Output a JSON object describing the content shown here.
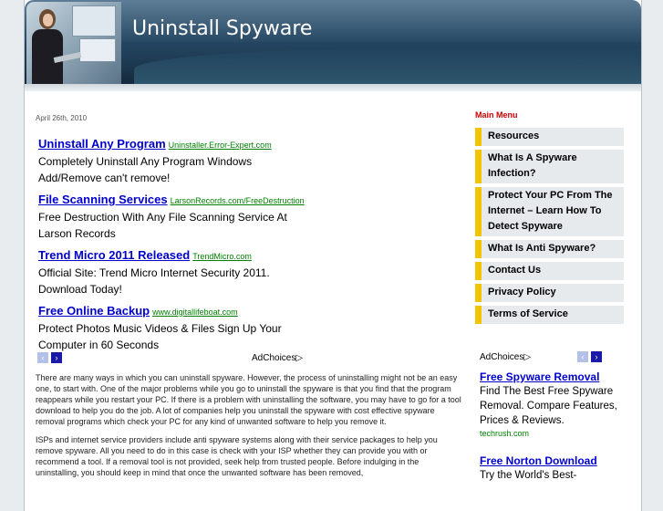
{
  "header": {
    "title": "Uninstall Spyware"
  },
  "post": {
    "date": "April 26th, 2010"
  },
  "ads": [
    {
      "title": "Uninstall Any Program",
      "url": "Uninstaller.Error-Expert.com",
      "text": "Completely Uninstall Any Program Windows Add/Remove can't remove!"
    },
    {
      "title": "File Scanning Services",
      "url": "LarsonRecords.com/FreeDestruction",
      "text": "Free Destruction With Any File Scanning Service At Larson Records"
    },
    {
      "title": "Trend Micro 2011 Released",
      "url": "TrendMicro.com",
      "text": "Official Site: Trend Micro Internet Security 2011. Download Today!"
    },
    {
      "title": "Free Online Backup",
      "url": "www.digitallifeboat.com",
      "text": "Protect Photos Music Videos & Files Sign Up Your Computer in 60 Seconds"
    }
  ],
  "adchoices": {
    "label": "AdChoices",
    "icon": "adchoices-triangle-icon",
    "prev_glyph": "‹",
    "next_glyph": "›"
  },
  "article": {
    "paragraphs": [
      "There are many ways in which you can uninstall spyware. However, the process of uninstalling might not be an easy one, to start with. One of the major problems while you go to uninstall the spyware is that you find that the program reappears while you restart your PC. If there is a problem with uninstalling the software, you may have to go for a tool download to help you do the job. A lot of companies help you uninstall the spyware with cost effective spyware removal programs which check your PC for any kind of unwanted software to help you remove it.",
      "ISPs and internet service providers include anti spyware systems along with their service packages to help you remove spyware. All you need to do in this case is check with your ISP whether they can provide you with or recommend a tool. If a removal tool is not provided, seek help from trusted people. Before indulging in the uninstalling, you should keep in mind that once the unwanted software has been removed,"
    ]
  },
  "sidebar": {
    "menu_title": "Main Menu",
    "items": [
      "Resources",
      "What Is A Spyware Infection?",
      "Protect Your PC From The Internet – Learn How To Detect Spyware",
      "What Is Anti Spyware?",
      "Contact Us",
      "Privacy Policy",
      "Terms of Service"
    ],
    "ads": [
      {
        "title": "Free Spyware Removal",
        "text": "Find The Best Free Spyware Removal. Compare Features, Prices & Reviews.",
        "url": "techrush.com"
      },
      {
        "title": "Free Norton Download",
        "text": "Try the World's Best-"
      }
    ]
  },
  "colors": {
    "link": "#0000cc",
    "url": "#008000",
    "menu_accent": "#f2c300",
    "menu_title": "#cc0000"
  }
}
